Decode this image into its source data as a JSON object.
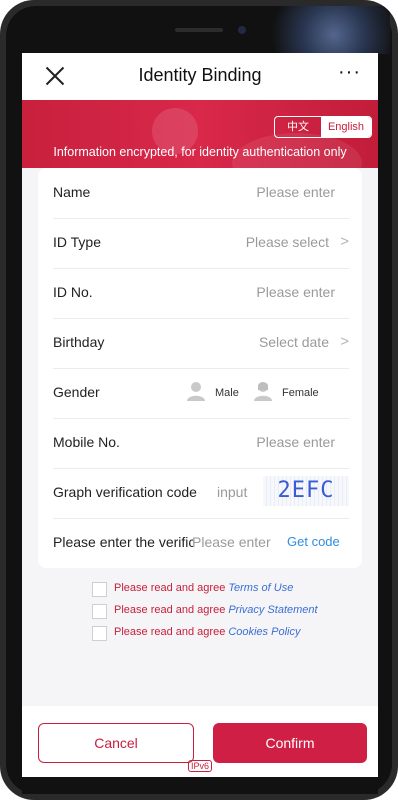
{
  "header": {
    "title": "Identity Binding",
    "more": "···"
  },
  "banner": {
    "lang_zh": "中文",
    "lang_en": "English",
    "notice": "Information encrypted, for identity authentication only"
  },
  "form": {
    "name": {
      "label": "Name",
      "placeholder": "Please enter"
    },
    "id_type": {
      "label": "ID Type",
      "placeholder": "Please select",
      "chevron": ">"
    },
    "id_no": {
      "label": "ID No.",
      "placeholder": "Please enter"
    },
    "birthday": {
      "label": "Birthday",
      "placeholder": "Select date",
      "chevron": ">"
    },
    "gender": {
      "label": "Gender",
      "male": "Male",
      "female": "Female"
    },
    "mobile": {
      "label": "Mobile No.",
      "placeholder": "Please enter"
    },
    "captcha": {
      "label": "Graph verification code",
      "placeholder": "input",
      "code": "2EFC"
    },
    "verification": {
      "label": "Please enter the verification code",
      "placeholder": "Please enter",
      "get_code": "Get code"
    }
  },
  "agreements": [
    {
      "prefix": "Please read and agree",
      "link": "Terms of Use"
    },
    {
      "prefix": "Please read and agree",
      "link": "Privacy Statement"
    },
    {
      "prefix": "Please read and agree",
      "link": "Cookies Policy"
    }
  ],
  "footer": {
    "cancel": "Cancel",
    "confirm": "Confirm",
    "ipv6": "IPv6"
  },
  "colors": {
    "brand": "#c8203d",
    "link": "#3a6ed6"
  }
}
